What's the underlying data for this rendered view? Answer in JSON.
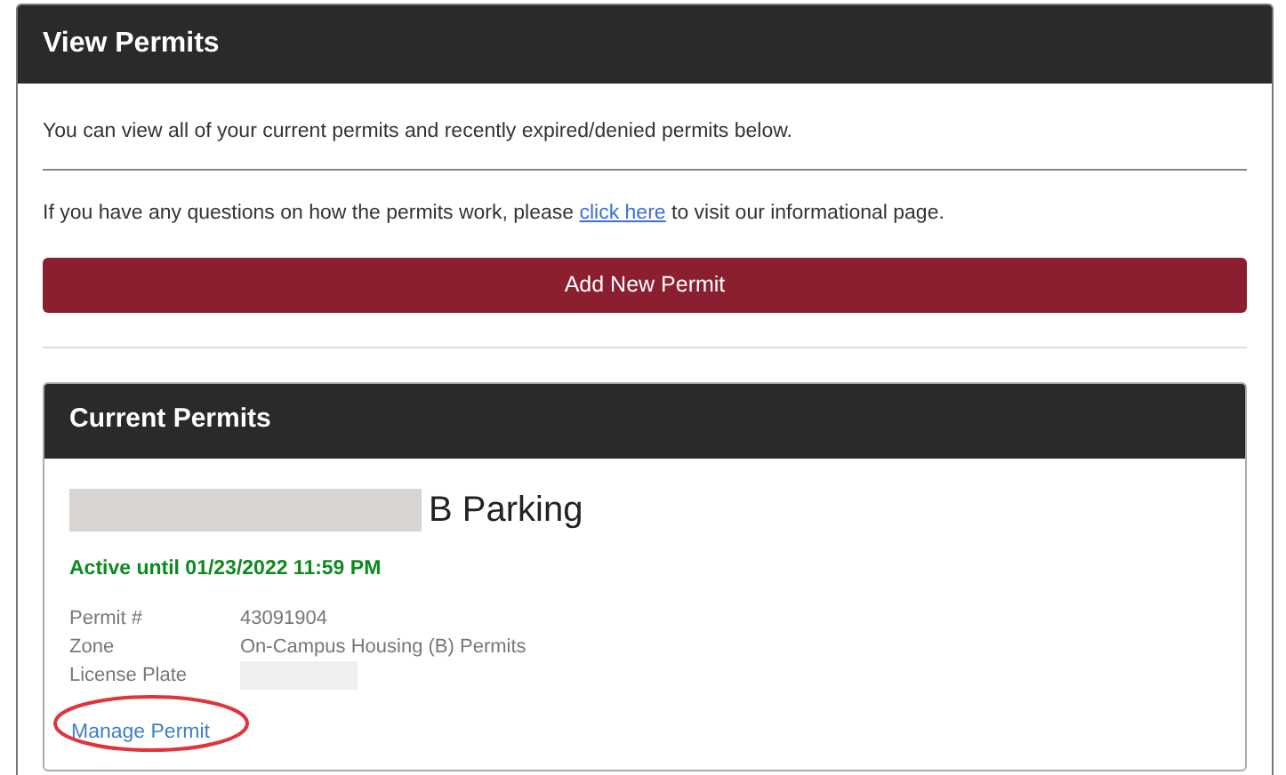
{
  "panel": {
    "title": "View Permits"
  },
  "intro": "You can view all of your current permits and recently expired/denied permits below.",
  "info": {
    "before": "If you have any questions on how the permits work, please ",
    "link": "click here",
    "after": " to visit our informational page."
  },
  "add_button": "Add New Permit",
  "current_permits": {
    "title": "Current Permits",
    "permits": [
      {
        "name": "B Parking",
        "status": "Active until 01/23/2022 11:59 PM",
        "active": true,
        "details": [
          {
            "label": "Permit #",
            "value": "43091904"
          },
          {
            "label": "Zone",
            "value": "On-Campus Housing (B) Permits"
          },
          {
            "label": "License Plate"
          }
        ],
        "manage_link": "Manage Permit",
        "highlighted": true
      }
    ]
  }
}
